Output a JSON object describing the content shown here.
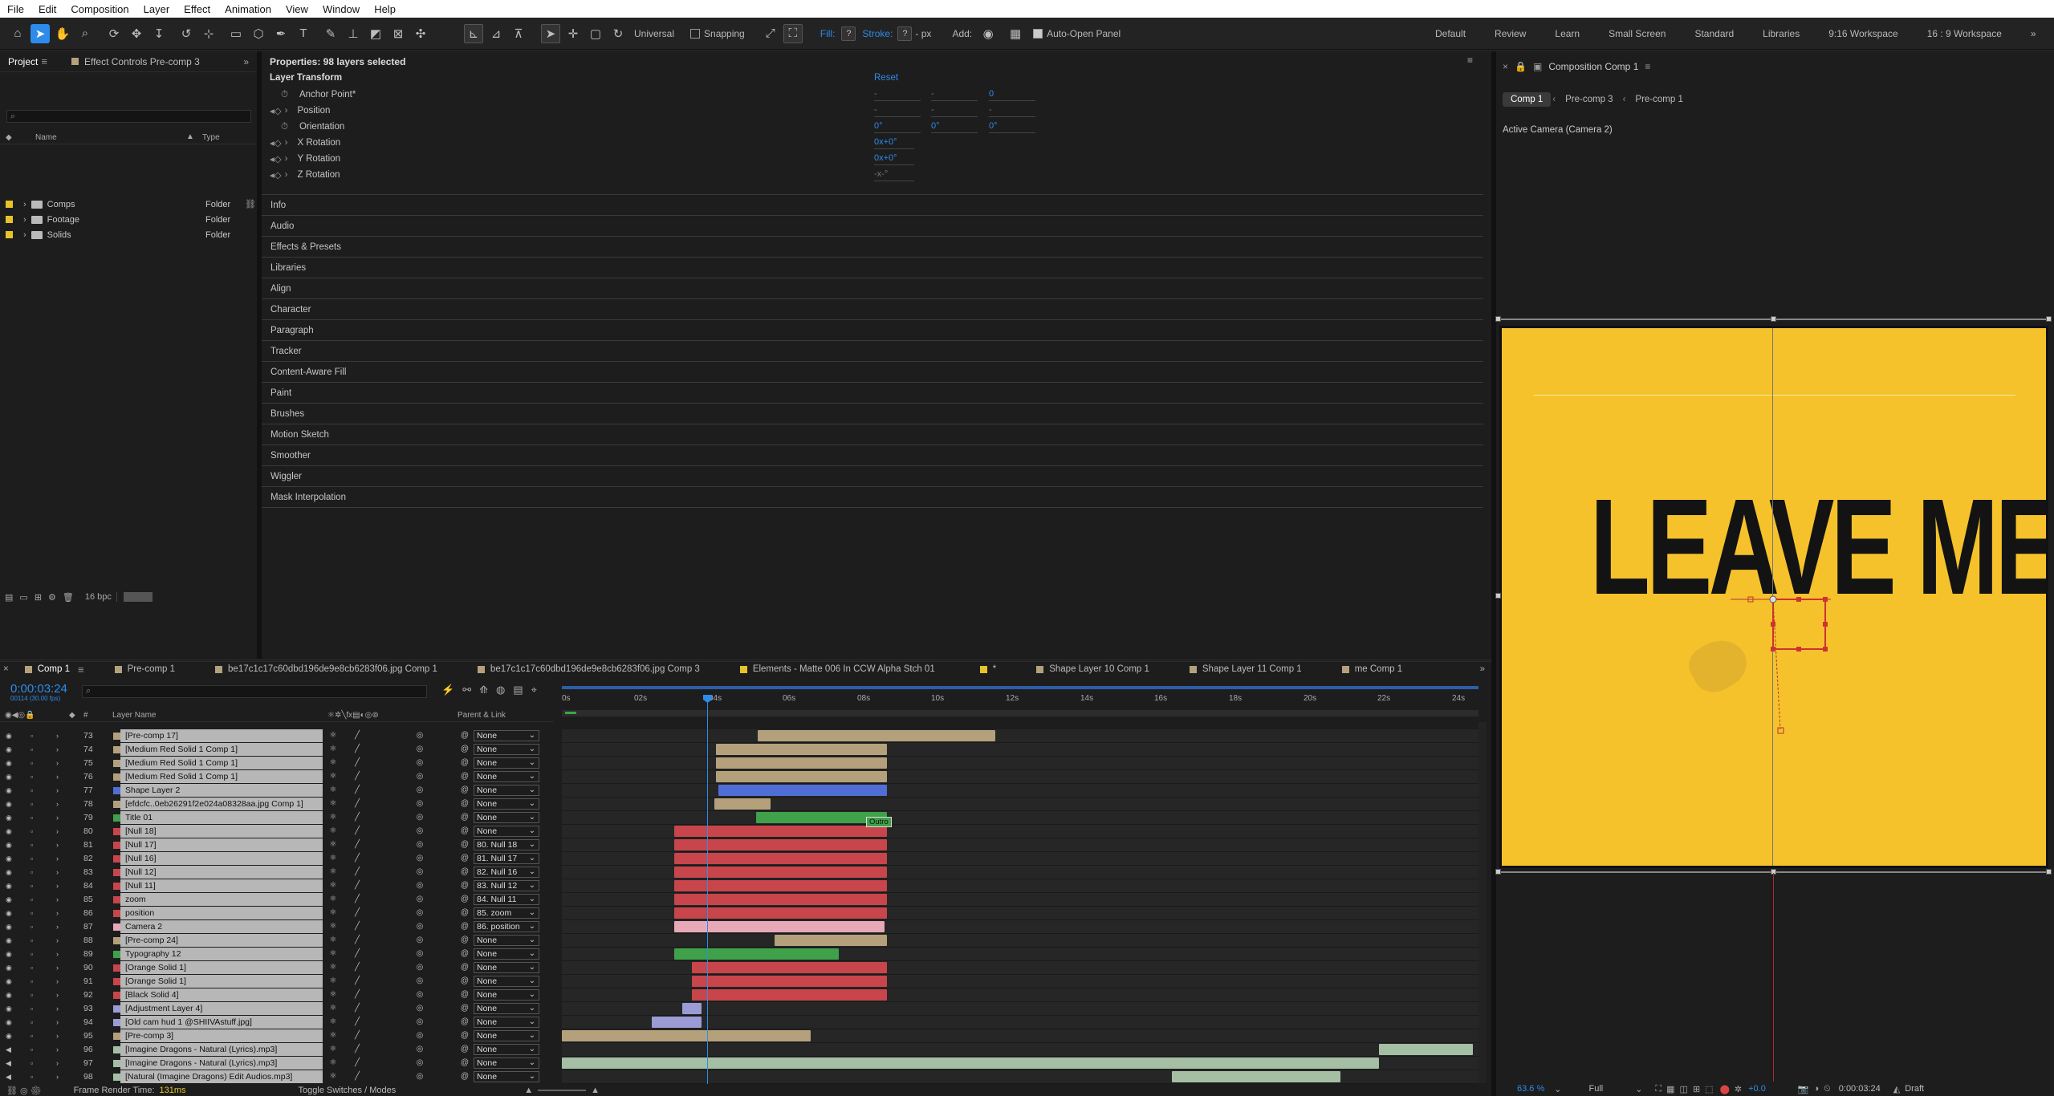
{
  "menu": [
    "File",
    "Edit",
    "Composition",
    "Layer",
    "Effect",
    "Animation",
    "View",
    "Window",
    "Help"
  ],
  "toolbar": {
    "universal": "Universal",
    "snapping": "Snapping",
    "fill": "Fill:",
    "fill_val": "?",
    "stroke": "Stroke:",
    "stroke_val": "?",
    "px": "- px",
    "add": "Add:",
    "auto_open": "Auto-Open Panel",
    "workspaces": [
      "Default",
      "Review",
      "Learn",
      "Small Screen",
      "Standard",
      "Libraries",
      "9:16 Workspace",
      "16 : 9 Workspace"
    ]
  },
  "project": {
    "tab": "Project",
    "tab2": "Effect Controls Pre-comp 3",
    "search_placeholder": "",
    "col_name": "Name",
    "col_type": "Type",
    "items": [
      {
        "name": "Comps",
        "type": "Folder"
      },
      {
        "name": "Footage",
        "type": "Folder"
      },
      {
        "name": "Solids",
        "type": "Folder"
      }
    ],
    "bpc": "16 bpc"
  },
  "properties": {
    "title": "Properties: 98 layers selected",
    "section": "Layer Transform",
    "reset": "Reset",
    "rows": [
      "Anchor Point*",
      "Position",
      "Orientation",
      "X Rotation",
      "Y Rotation",
      "Z Rotation"
    ],
    "anchor_vals": [
      "-",
      "-",
      "0"
    ],
    "position_vals": [
      "-",
      "-",
      "-"
    ],
    "orientation_vals": [
      "0°",
      "0°",
      "0°"
    ],
    "xrot": "0x+0°",
    "yrot": "0x+0°",
    "zrot": "-x-°",
    "panels": [
      "Info",
      "Audio",
      "Effects & Presets",
      "Libraries",
      "Align",
      "Character",
      "Paragraph",
      "Tracker",
      "Content-Aware Fill",
      "Paint",
      "Brushes",
      "Motion Sketch",
      "Smoother",
      "Wiggler",
      "Mask Interpolation"
    ]
  },
  "composition": {
    "header": "Composition Comp 1",
    "tabs": [
      "Comp 1",
      "Pre-comp 3",
      "Pre-comp 1"
    ],
    "camera": "Active Camera (Camera 2)",
    "canvas_text": "LEAVE ME",
    "zoom": "63.6 %",
    "resolution": "Full",
    "exposure": "+0.0",
    "timecode": "0:00:03:24",
    "view": "Draft"
  },
  "timeline": {
    "tabs": [
      "Comp 1",
      "Pre-comp 1",
      "be17c1c17c60dbd196de9e8cb6283f06.jpg Comp 1",
      "be17c1c17c60dbd196de9e8cb6283f06.jpg Comp 3",
      "Elements - Matte 006 In CCW Alpha Stch 01",
      "*",
      "Shape Layer 10 Comp 1",
      "Shape Layer 11 Comp 1",
      "me Comp 1"
    ],
    "timecode": "0:00:03:24",
    "fps": "00114 (30.00 fps)",
    "col_layer": "Layer Name",
    "col_parent": "Parent & Link",
    "ruler": [
      "0s",
      "02s",
      "04s",
      "06s",
      "08s",
      "10s",
      "12s",
      "14s",
      "16s",
      "18s",
      "20s",
      "22s",
      "24s"
    ],
    "layers": [
      {
        "num": "73",
        "name": "[Pre-comp 17]",
        "parent": "None",
        "color": "#b4a17c"
      },
      {
        "num": "74",
        "name": "[Medium Red Solid 1 Comp 1]",
        "parent": "None",
        "color": "#b4a17c"
      },
      {
        "num": "75",
        "name": "[Medium Red Solid 1 Comp 1]",
        "parent": "None",
        "color": "#b4a17c"
      },
      {
        "num": "76",
        "name": "[Medium Red Solid 1 Comp 1]",
        "parent": "None",
        "color": "#b4a17c"
      },
      {
        "num": "77",
        "name": "Shape Layer 2",
        "parent": "None",
        "color": "#4f6fd6"
      },
      {
        "num": "78",
        "name": "[efdcfc..0eb26291f2e024a08328aa.jpg Comp 1]",
        "parent": "None",
        "color": "#b4a17c"
      },
      {
        "num": "79",
        "name": "Title 01",
        "parent": "None",
        "color": "#3fa14a"
      },
      {
        "num": "80",
        "name": "[Null 18]",
        "parent": "None",
        "color": "#c8454b"
      },
      {
        "num": "81",
        "name": "[Null 17]",
        "parent": "80. Null 18",
        "color": "#c8454b"
      },
      {
        "num": "82",
        "name": "[Null 16]",
        "parent": "81. Null 17",
        "color": "#c8454b"
      },
      {
        "num": "83",
        "name": "[Null 12]",
        "parent": "82. Null 16",
        "color": "#c8454b"
      },
      {
        "num": "84",
        "name": "[Null 11]",
        "parent": "83. Null 12",
        "color": "#c8454b"
      },
      {
        "num": "85",
        "name": "zoom",
        "parent": "84. Null 11",
        "color": "#c8454b"
      },
      {
        "num": "86",
        "name": "position",
        "parent": "85. zoom",
        "color": "#c8454b"
      },
      {
        "num": "87",
        "name": "Camera 2",
        "parent": "86. position",
        "color": "#e7a9b7"
      },
      {
        "num": "88",
        "name": "[Pre-comp 24]",
        "parent": "None",
        "color": "#b4a17c"
      },
      {
        "num": "89",
        "name": "Typography 12",
        "parent": "None",
        "color": "#3fa14a"
      },
      {
        "num": "90",
        "name": "[Orange Solid 1]",
        "parent": "None",
        "color": "#c8454b"
      },
      {
        "num": "91",
        "name": "[Orange Solid 1]",
        "parent": "None",
        "color": "#c8454b"
      },
      {
        "num": "92",
        "name": "[Black Solid 4]",
        "parent": "None",
        "color": "#c8454b"
      },
      {
        "num": "93",
        "name": "[Adjustment Layer 4]",
        "parent": "None",
        "color": "#9b9bd6"
      },
      {
        "num": "94",
        "name": "[Old cam hud 1 @SHIIVAstuff.jpg]",
        "parent": "None",
        "color": "#9b9bd6"
      },
      {
        "num": "95",
        "name": "[Pre-comp 3]",
        "parent": "None",
        "color": "#b4a17c"
      },
      {
        "num": "96",
        "name": "[Imagine Dragons - Natural (Lyrics).mp3]",
        "parent": "None",
        "color": "#a4bfa3"
      },
      {
        "num": "97",
        "name": "[Imagine Dragons - Natural (Lyrics).mp3]",
        "parent": "None",
        "color": "#a4bfa3"
      },
      {
        "num": "98",
        "name": "[Natural (Imagine Dragons) Edit Audios.mp3]",
        "parent": "None",
        "color": "#a4bfa3"
      }
    ],
    "outro_label": "Outro",
    "frame_render": "Frame Render Time:",
    "frame_render_val": "131ms",
    "toggle": "Toggle Switches / Modes"
  }
}
